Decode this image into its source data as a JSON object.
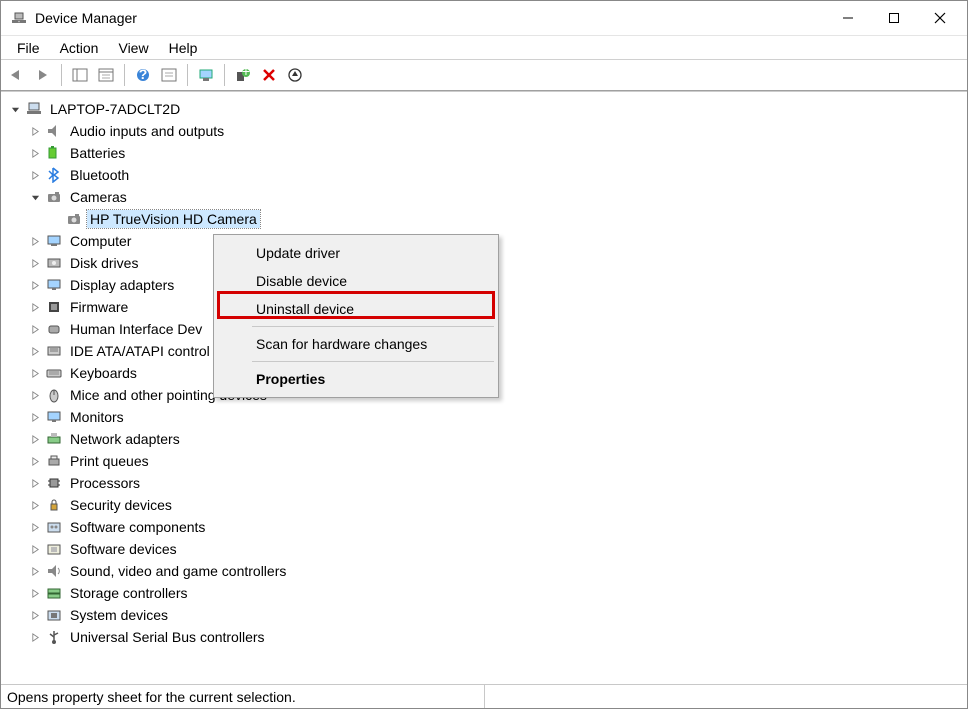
{
  "window": {
    "title": "Device Manager"
  },
  "menubar": {
    "file": "File",
    "action": "Action",
    "view": "View",
    "help": "Help"
  },
  "tree": {
    "root": "LAPTOP-7ADCLT2D",
    "items": [
      {
        "label": "Audio inputs and outputs",
        "expanded": false,
        "icon": "audio"
      },
      {
        "label": "Batteries",
        "expanded": false,
        "icon": "battery"
      },
      {
        "label": "Bluetooth",
        "expanded": false,
        "icon": "bluetooth"
      },
      {
        "label": "Cameras",
        "expanded": true,
        "icon": "camera",
        "children": [
          {
            "label": "HP TrueVision HD Camera",
            "icon": "camera",
            "selected": true
          }
        ]
      },
      {
        "label": "Computer",
        "expanded": false,
        "icon": "computer"
      },
      {
        "label": "Disk drives",
        "expanded": false,
        "icon": "disk"
      },
      {
        "label": "Display adapters",
        "expanded": false,
        "icon": "display"
      },
      {
        "label": "Firmware",
        "expanded": false,
        "icon": "firmware"
      },
      {
        "label": "Human Interface Devices",
        "expanded": false,
        "icon": "hid",
        "truncated": "Human Interface Dev"
      },
      {
        "label": "IDE ATA/ATAPI controllers",
        "expanded": false,
        "icon": "ide",
        "truncated": "IDE ATA/ATAPI control"
      },
      {
        "label": "Keyboards",
        "expanded": false,
        "icon": "keyboard"
      },
      {
        "label": "Mice and other pointing devices",
        "expanded": false,
        "icon": "mouse"
      },
      {
        "label": "Monitors",
        "expanded": false,
        "icon": "monitor"
      },
      {
        "label": "Network adapters",
        "expanded": false,
        "icon": "network"
      },
      {
        "label": "Print queues",
        "expanded": false,
        "icon": "print"
      },
      {
        "label": "Processors",
        "expanded": false,
        "icon": "cpu"
      },
      {
        "label": "Security devices",
        "expanded": false,
        "icon": "security"
      },
      {
        "label": "Software components",
        "expanded": false,
        "icon": "sw-comp"
      },
      {
        "label": "Software devices",
        "expanded": false,
        "icon": "sw-dev"
      },
      {
        "label": "Sound, video and game controllers",
        "expanded": false,
        "icon": "sound"
      },
      {
        "label": "Storage controllers",
        "expanded": false,
        "icon": "storage"
      },
      {
        "label": "System devices",
        "expanded": false,
        "icon": "system"
      },
      {
        "label": "Universal Serial Bus controllers",
        "expanded": false,
        "icon": "usb"
      }
    ]
  },
  "context_menu": {
    "update_driver": "Update driver",
    "disable_device": "Disable device",
    "uninstall_device": "Uninstall device",
    "scan_hardware": "Scan for hardware changes",
    "properties": "Properties"
  },
  "statusbar": {
    "text": "Opens property sheet for the current selection."
  },
  "toolbar_icons": [
    "back",
    "fwd",
    "prop-win",
    "prop-list",
    "help",
    "refresh-pane",
    "sep",
    "scan-monitor",
    "sep",
    "install",
    "delete",
    "info"
  ]
}
